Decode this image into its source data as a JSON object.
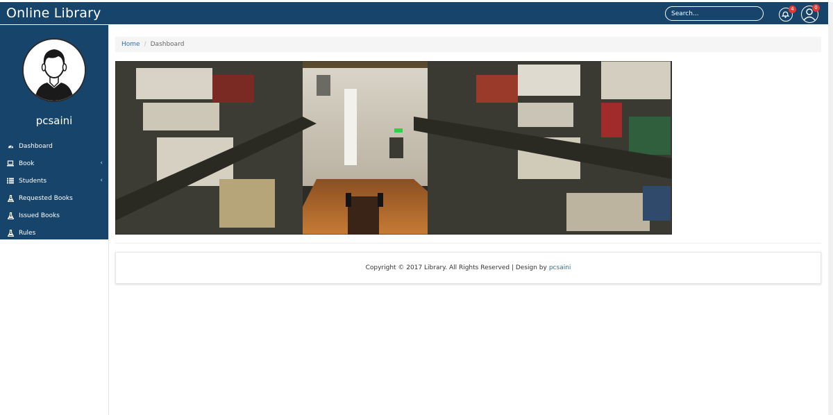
{
  "header": {
    "brand": "Online Library",
    "search_placeholder": "Search...",
    "notification_count": "4",
    "user_count": "0"
  },
  "sidebar": {
    "username": "pcsaini",
    "items": [
      {
        "label": "Dashboard",
        "icon": "dashboard-icon",
        "has_submenu": false
      },
      {
        "label": "Book",
        "icon": "laptop-icon",
        "has_submenu": true
      },
      {
        "label": "Students",
        "icon": "list-icon",
        "has_submenu": true
      },
      {
        "label": "Requested Books",
        "icon": "flask-icon",
        "has_submenu": false
      },
      {
        "label": "Issued Books",
        "icon": "flask-icon",
        "has_submenu": false
      },
      {
        "label": "Rules",
        "icon": "flask-icon",
        "has_submenu": false
      }
    ]
  },
  "breadcrumb": {
    "home": "Home",
    "separator": "/",
    "current": "Dashboard"
  },
  "footer": {
    "text": "Copyright © 2017 Library. All Rights Reserved | Design by",
    "link": "pcsaini"
  },
  "colors": {
    "primary": "#17446b",
    "link": "#2a6fb0",
    "badge": "#e53935"
  }
}
